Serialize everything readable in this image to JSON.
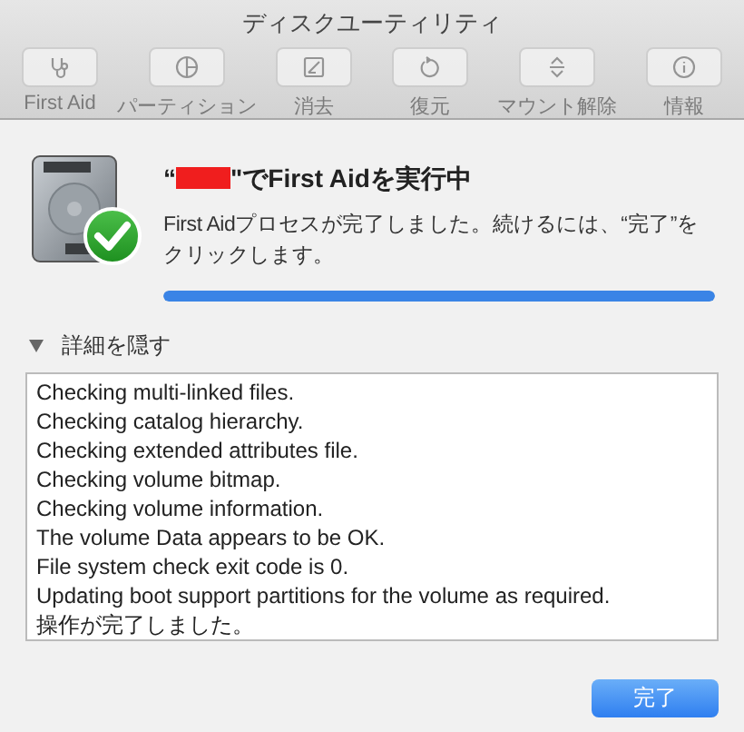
{
  "window": {
    "title": "ディスクユーティリティ"
  },
  "toolbar": [
    {
      "label": "First Aid",
      "kind": "stethoscope",
      "disabled": true
    },
    {
      "label": "パーティション",
      "kind": "pie",
      "disabled": true
    },
    {
      "label": "消去",
      "kind": "erase",
      "disabled": true
    },
    {
      "label": "復元",
      "kind": "restore",
      "disabled": true
    },
    {
      "label": "マウント解除",
      "kind": "eject",
      "disabled": true
    },
    {
      "label": "情報",
      "kind": "info",
      "disabled": true
    }
  ],
  "dialog": {
    "title_before": "“",
    "title_redacted": true,
    "title_after": "\"でFirst Aidを実行中",
    "message": "First Aidプロセスが完了しました。続けるには、“完了”をクリックします。",
    "progress": {
      "level": 1.0
    },
    "details_toggle": {
      "label": "詳細を隠す",
      "expanded": true
    },
    "log": [
      "Checking multi-linked files.",
      "Checking catalog hierarchy.",
      "Checking extended attributes file.",
      "Checking volume bitmap.",
      "Checking volume information.",
      "The volume Data appears to be OK.",
      "File system check exit code is 0.",
      "Updating boot support partitions for the volume as required.",
      "操作が完了しました。"
    ],
    "done_button": {
      "label": "完了"
    }
  }
}
